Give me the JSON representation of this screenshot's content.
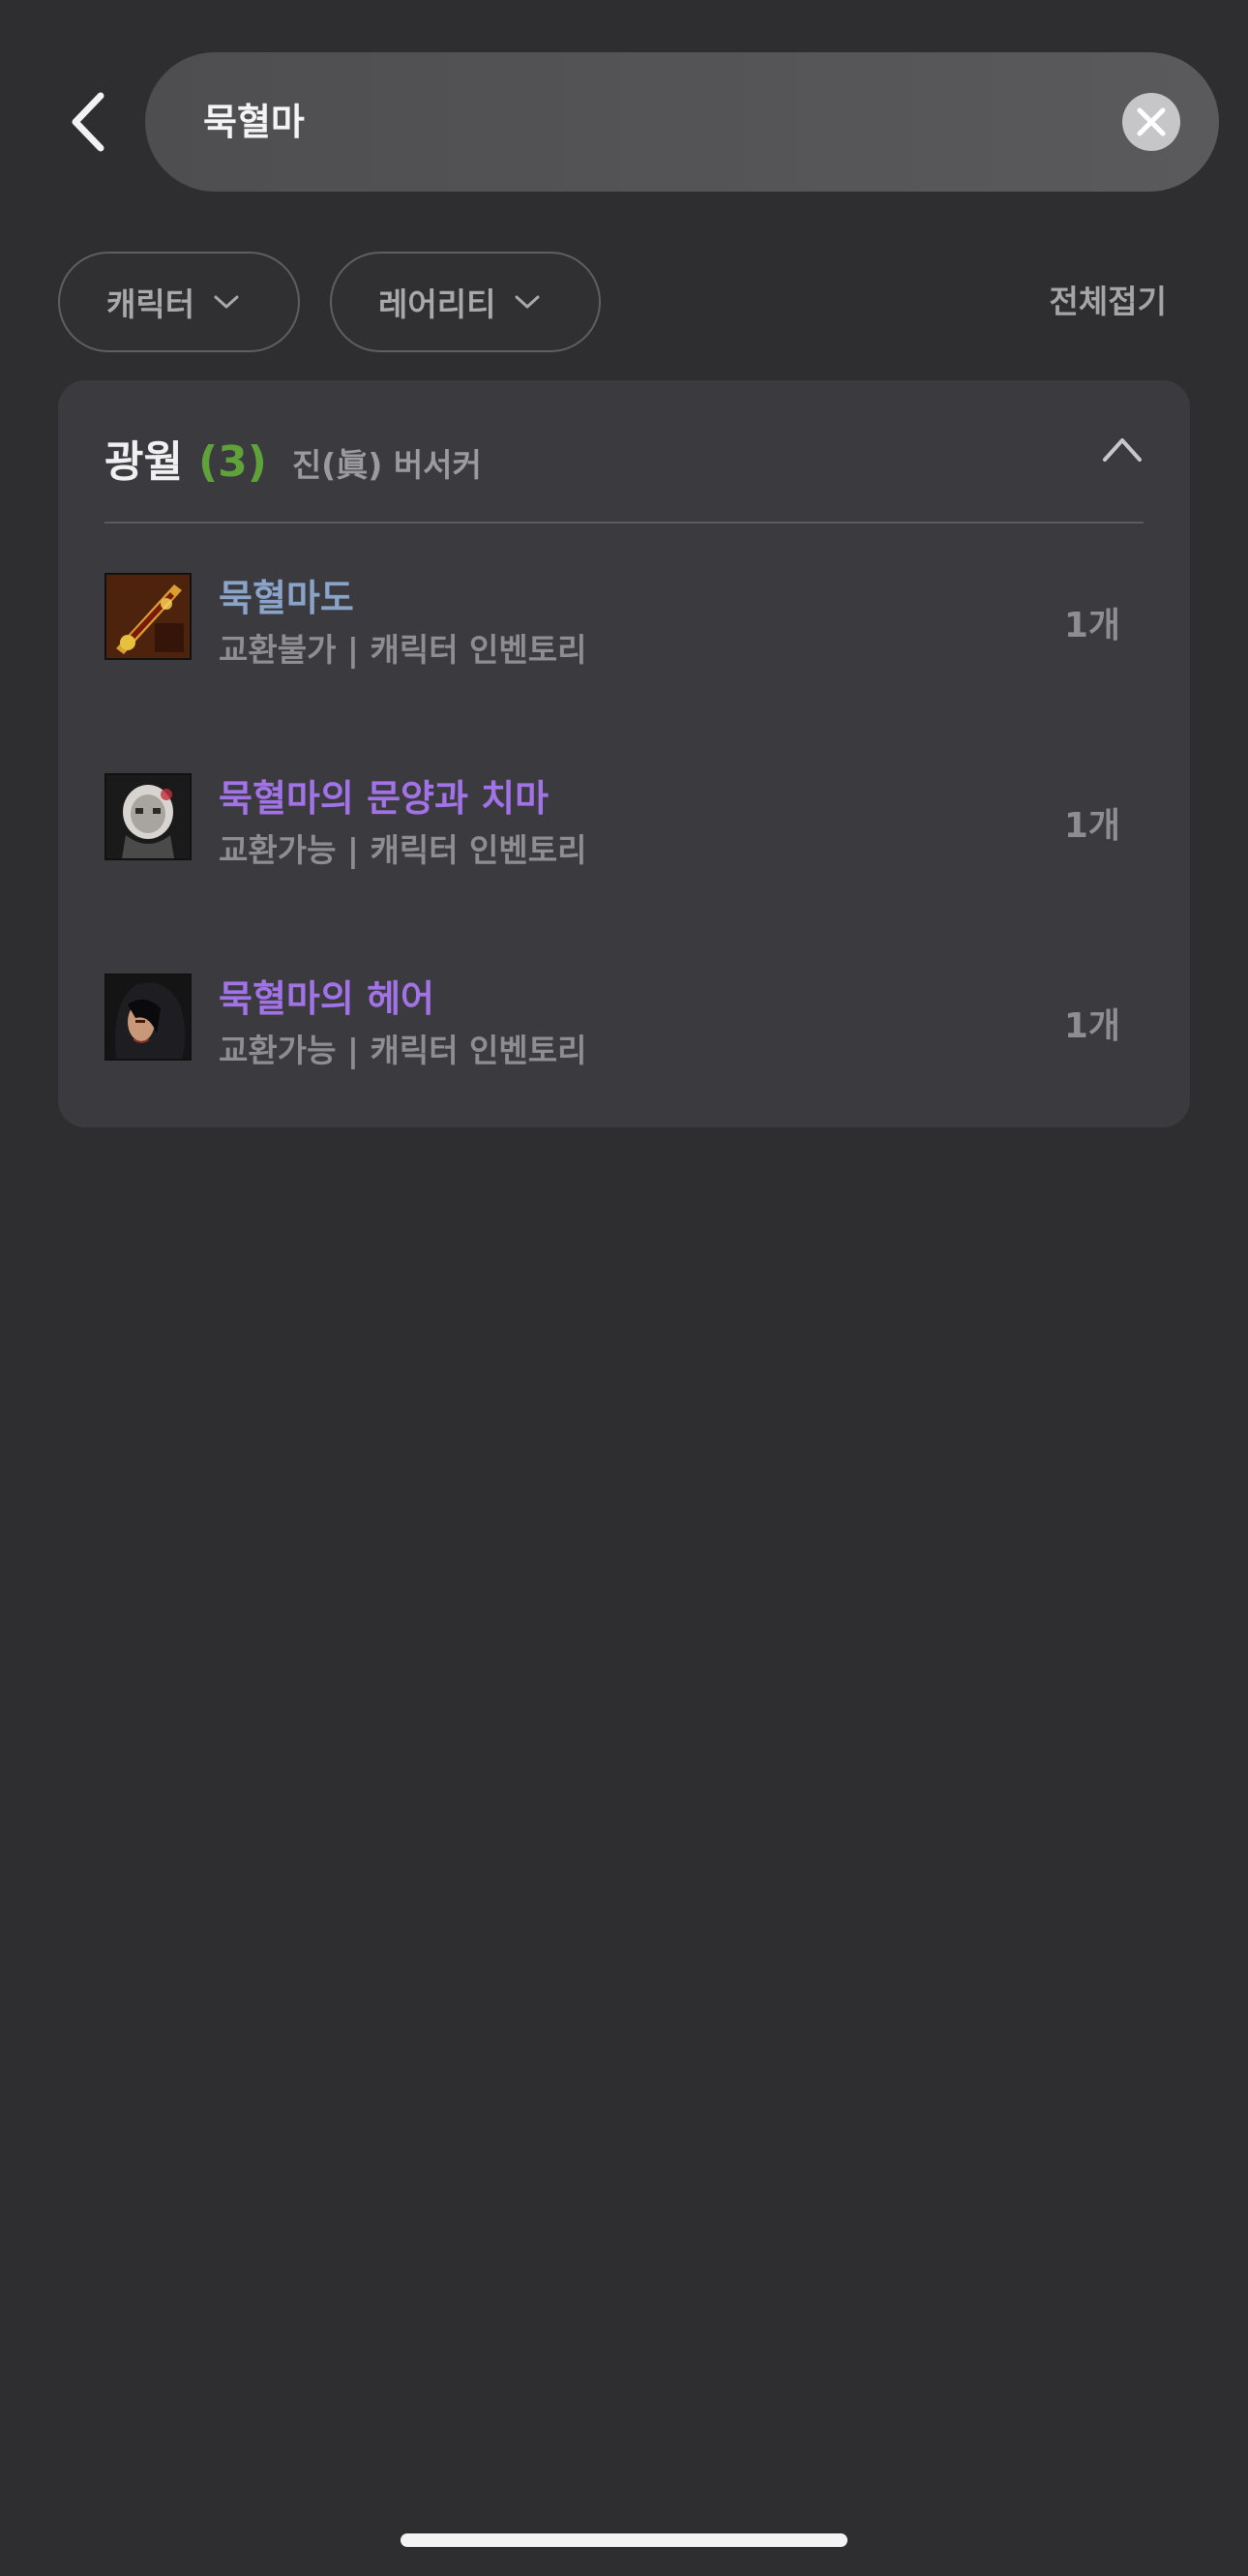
{
  "search": {
    "query": "묵혈마"
  },
  "filters": {
    "character_label": "캐릭터",
    "rarity_label": "레어리티",
    "collapse_all_label": "전체접기"
  },
  "group": {
    "server": "광월",
    "count": "(3)",
    "character_class": "진(眞) 버서커",
    "items": [
      {
        "name": "묵혈마도",
        "name_color": "#8aa3c8",
        "meta": "교환불가 | 캐릭터 인벤토리",
        "qty": "1개",
        "icon": "sword-icon"
      },
      {
        "name": "묵혈마의 문양과 치마",
        "name_color": "#a273e6",
        "meta": "교환가능 | 캐릭터 인벤토리",
        "qty": "1개",
        "icon": "armor-icon"
      },
      {
        "name": "묵혈마의 헤어",
        "name_color": "#a273e6",
        "meta": "교환가능 | 캐릭터 인벤토리",
        "qty": "1개",
        "icon": "hair-icon"
      }
    ]
  }
}
